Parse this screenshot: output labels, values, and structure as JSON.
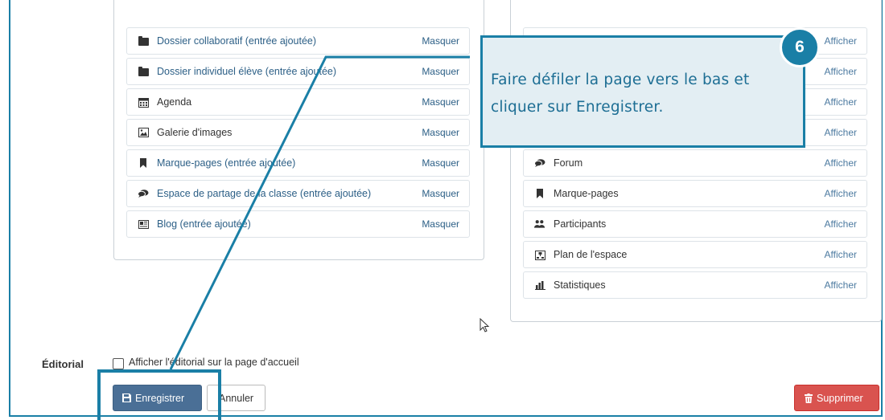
{
  "left_list": {
    "items": [
      {
        "label": "Dossier collaboratif (entrée ajoutée)",
        "action": "Masquer",
        "icon": "folder-icon"
      },
      {
        "label": "Dossier individuel élève (entrée ajoutée)",
        "action": "Masquer",
        "icon": "folder-icon"
      },
      {
        "label": "Agenda",
        "action": "Masquer",
        "icon": "calendar-icon"
      },
      {
        "label": "Galerie d'images",
        "action": "Masquer",
        "icon": "image-icon"
      },
      {
        "label": "Marque-pages (entrée ajoutée)",
        "action": "Masquer",
        "icon": "bookmark-icon"
      },
      {
        "label": "Espace de partage de la classe (entrée ajoutée)",
        "action": "Masquer",
        "icon": "comments-icon"
      },
      {
        "label": "Blog (entrée ajoutée)",
        "action": "Masquer",
        "icon": "blog-icon"
      }
    ]
  },
  "right_list": {
    "items": [
      {
        "label": "",
        "action": "Afficher",
        "icon": "user-icon"
      },
      {
        "label": "",
        "action": "Afficher",
        "icon": ""
      },
      {
        "label": "",
        "action": "Afficher",
        "icon": ""
      },
      {
        "label": "",
        "action": "Afficher",
        "icon": ""
      },
      {
        "label": "Forum",
        "action": "Afficher",
        "icon": "comments-icon"
      },
      {
        "label": "Marque-pages",
        "action": "Afficher",
        "icon": "bookmark-icon"
      },
      {
        "label": "Participants",
        "action": "Afficher",
        "icon": "users-icon"
      },
      {
        "label": "Plan de l'espace",
        "action": "Afficher",
        "icon": "sitemap-icon"
      },
      {
        "label": "Statistiques",
        "action": "Afficher",
        "icon": "bar-chart-icon"
      }
    ]
  },
  "callout": {
    "step": "6",
    "text_line1": "Faire défiler la page vers le bas et",
    "text_line2": "cliquer sur Enregistrer."
  },
  "editorial": {
    "label": "Éditorial",
    "checkbox_label": "Afficher l'éditorial sur la page d'accueil",
    "checked": false
  },
  "buttons": {
    "save": "Enregistrer",
    "cancel": "Annuler",
    "delete": "Supprimer"
  },
  "colors": {
    "callout_accent": "#1a7fa6",
    "save_button": "#4a6f96",
    "delete_button": "#d9534f",
    "link": "#2c5f86"
  }
}
